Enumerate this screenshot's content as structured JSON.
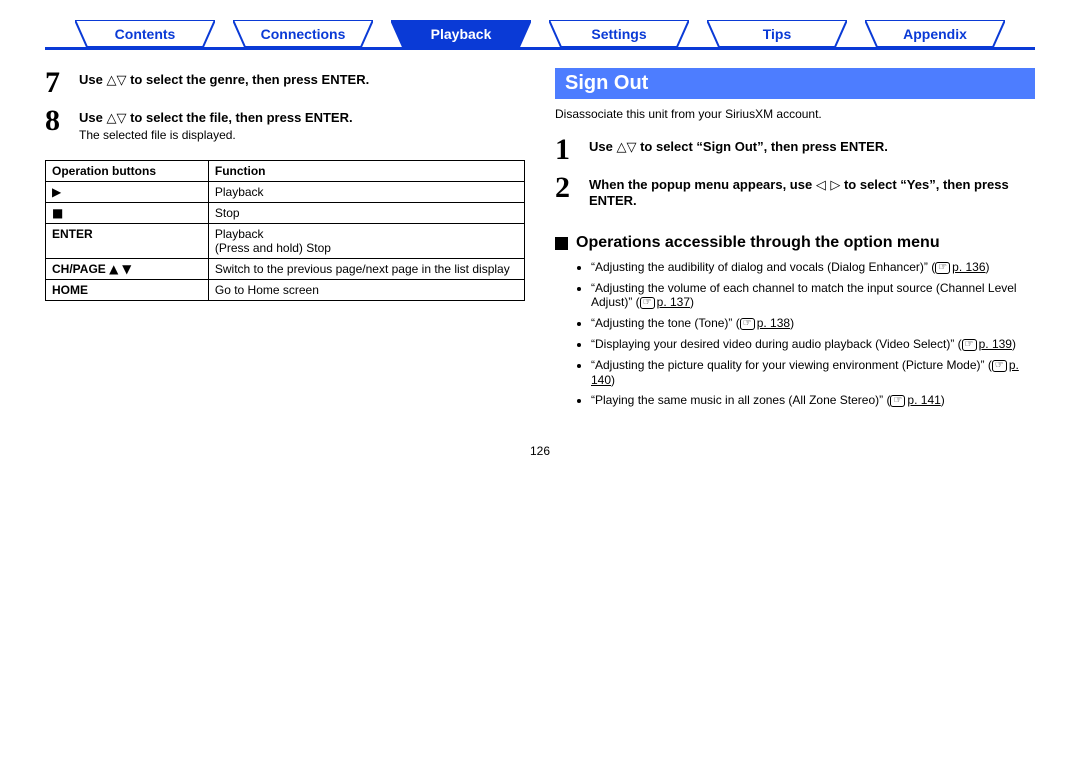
{
  "nav": {
    "tabs": [
      {
        "label": "Contents",
        "active": false
      },
      {
        "label": "Connections",
        "active": false
      },
      {
        "label": "Playback",
        "active": true
      },
      {
        "label": "Settings",
        "active": false
      },
      {
        "label": "Tips",
        "active": false
      },
      {
        "label": "Appendix",
        "active": false
      }
    ]
  },
  "left": {
    "steps": [
      {
        "num": "7",
        "title_pre": "Use ",
        "title_sym": "△▽",
        "title_post": " to select the genre, then press ENTER."
      },
      {
        "num": "8",
        "title_pre": "Use ",
        "title_sym": "△▽",
        "title_post": " to select the file, then press ENTER.",
        "note": "The selected file is displayed."
      }
    ],
    "table": {
      "headers": [
        "Operation buttons",
        "Function"
      ],
      "rows": [
        {
          "btn_sym": "▶",
          "btn_txt": "",
          "func": "Playback"
        },
        {
          "btn_sym": "■",
          "btn_txt": "",
          "func": "Stop"
        },
        {
          "btn_sym": "",
          "btn_txt": "ENTER",
          "func": "Playback\n(Press and hold) Stop"
        },
        {
          "btn_sym": "▲ ▼",
          "btn_txt": "CH/PAGE ",
          "func": "Switch to the previous page/next page in the list display"
        },
        {
          "btn_sym": "",
          "btn_txt": "HOME",
          "func": "Go to Home screen"
        }
      ]
    }
  },
  "right": {
    "section_title": "Sign Out",
    "section_desc": "Disassociate this unit from your SiriusXM account.",
    "steps": [
      {
        "num": "1",
        "title_pre": "Use ",
        "title_sym": "△▽",
        "title_post": " to select “Sign Out”, then press ENTER."
      },
      {
        "num": "2",
        "title_pre": "When the popup menu appears, use ",
        "title_sym": "◁ ▷",
        "title_post": " to select “Yes”, then press ENTER."
      }
    ],
    "sub_heading": "Operations accessible through the option menu",
    "bullets": [
      {
        "text": "“Adjusting the audibility of dialog and vocals (Dialog Enhancer)” (",
        "page": "p. 136",
        "suffix": ")"
      },
      {
        "text": "“Adjusting the volume of each channel to match the input source (Channel Level Adjust)” (",
        "page": "p. 137",
        "suffix": ")"
      },
      {
        "text": "“Adjusting the tone (Tone)” (",
        "page": "p. 138",
        "suffix": ")"
      },
      {
        "text": "“Displaying your desired video during audio playback (Video Select)” (",
        "page": "p. 139",
        "suffix": ")"
      },
      {
        "text": "“Adjusting the picture quality for your viewing environment (Picture Mode)” (",
        "page": "p. 140",
        "suffix": ")"
      },
      {
        "text": "“Playing the same music in all zones (All Zone Stereo)” (",
        "page": "p. 141",
        "suffix": ")"
      }
    ]
  },
  "page_number": "126"
}
